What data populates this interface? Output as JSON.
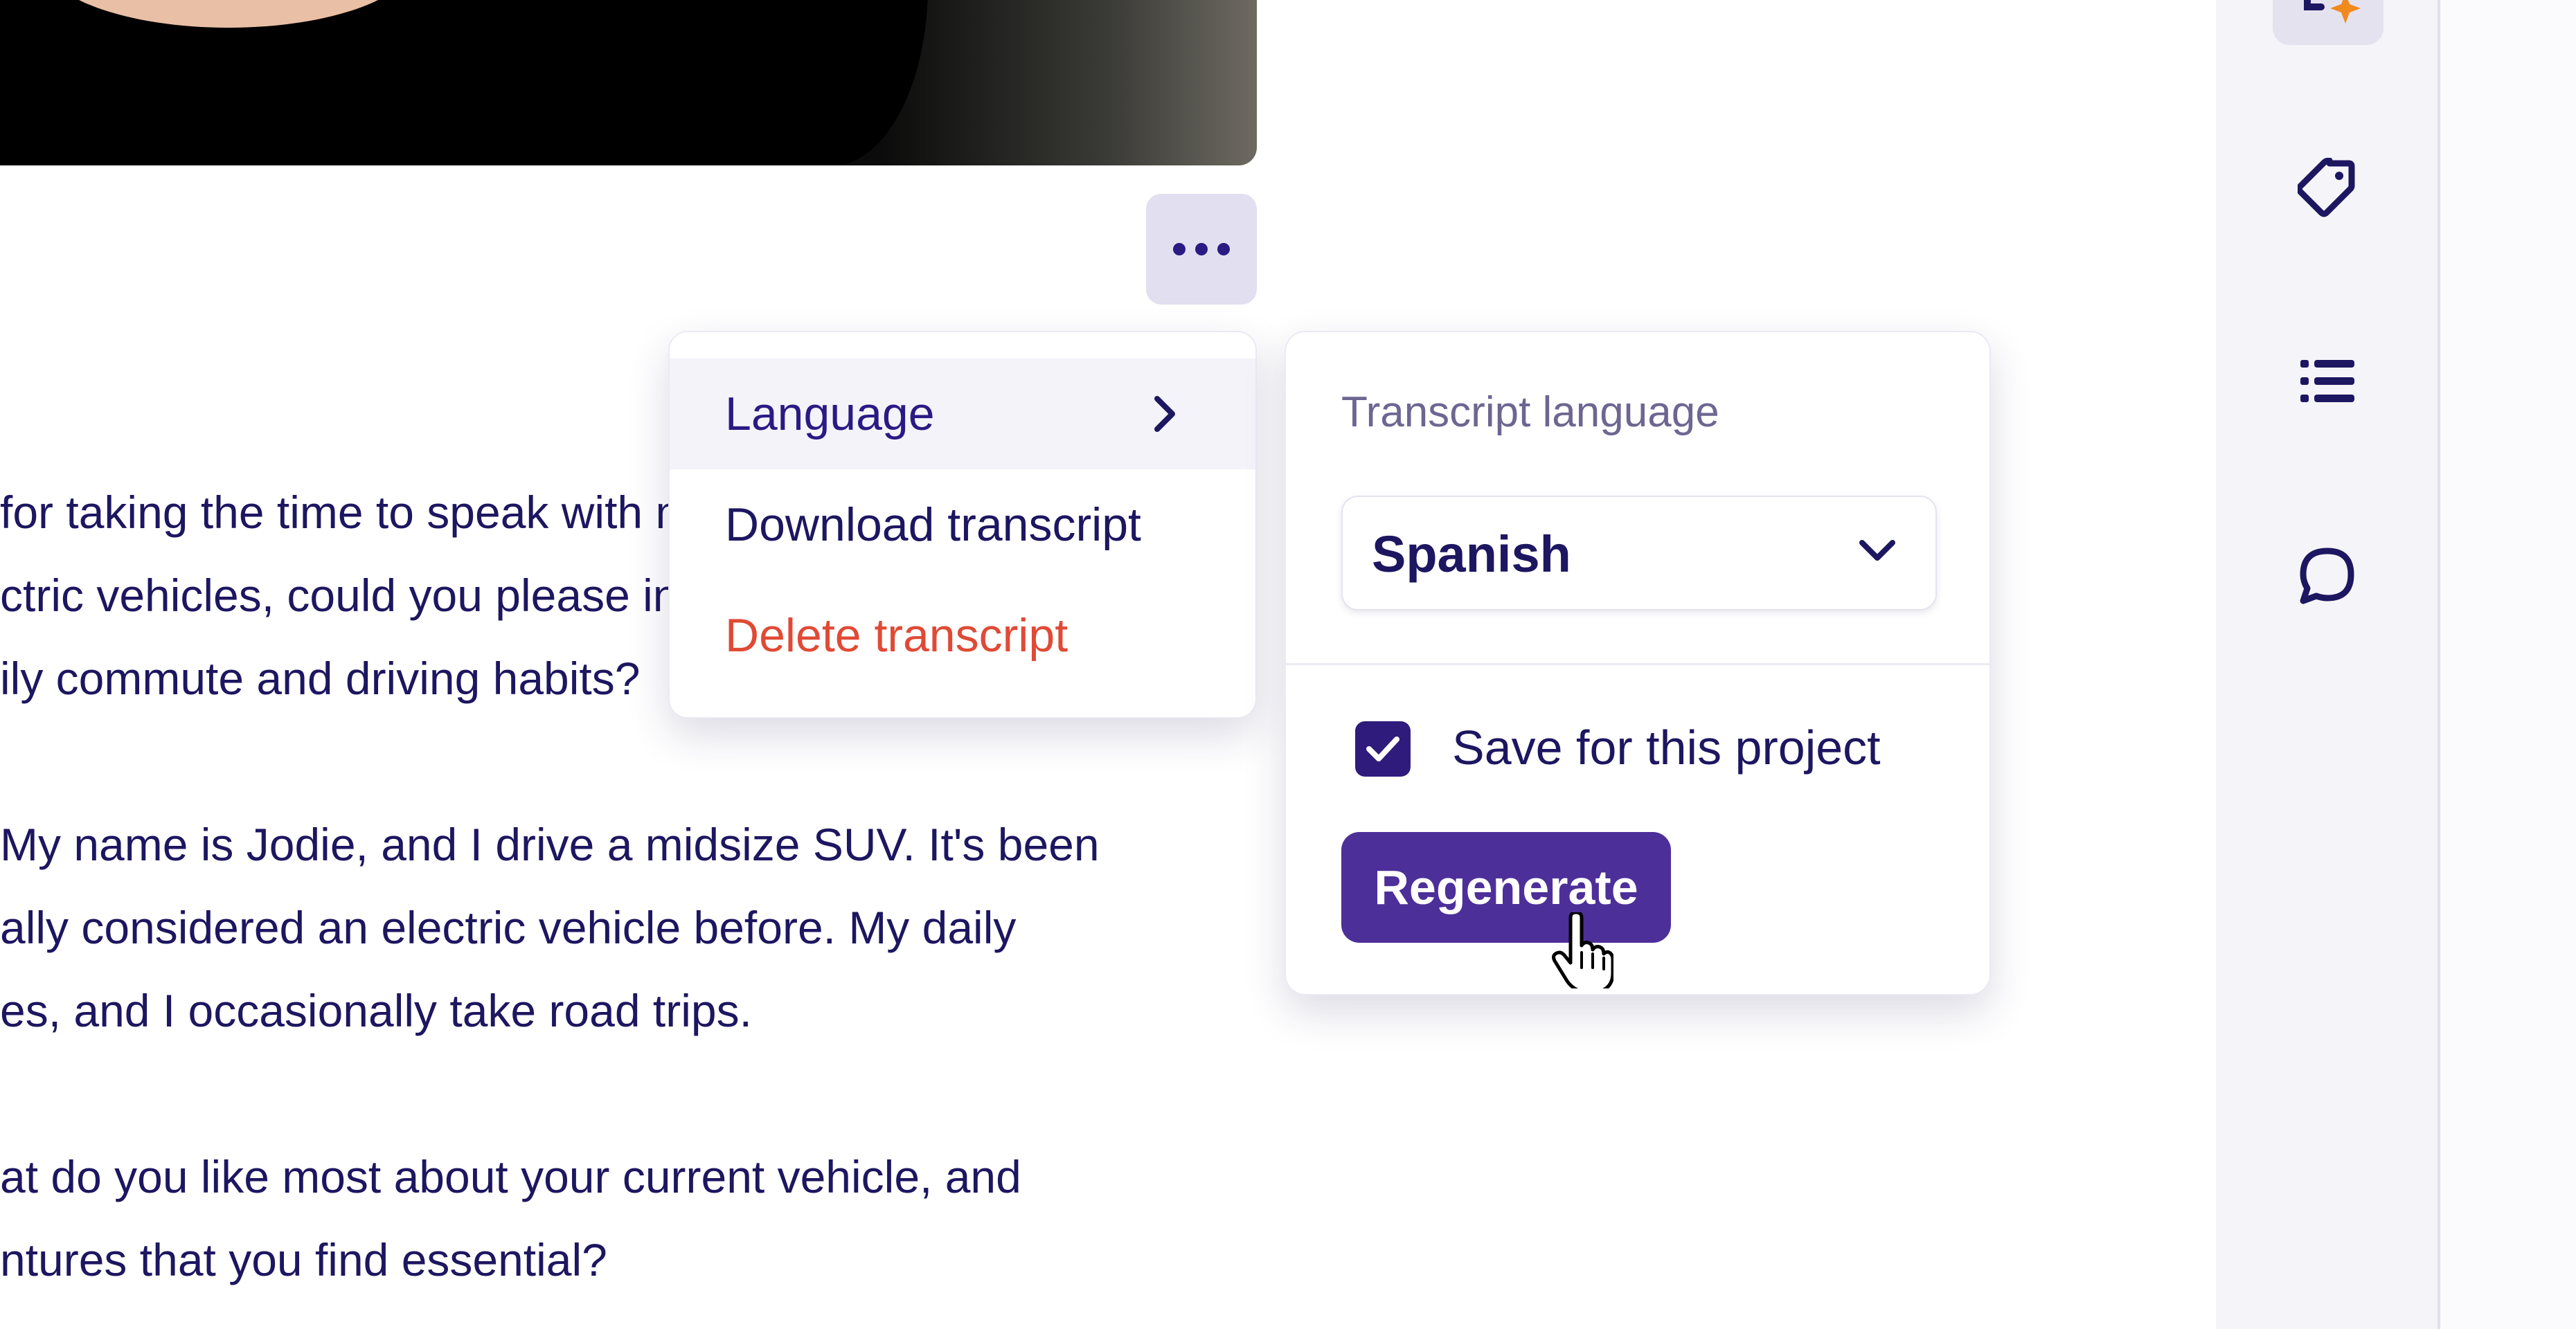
{
  "transcript": {
    "lines": [
      " for taking the time to speak with me about",
      "ctric vehicles, could you please introduce",
      "ily commute and driving habits?",
      "My name is Jodie, and I drive a midsize SUV. It's been",
      "ally considered an electric vehicle before. My daily",
      "es, and I occasionally take road trips.",
      "at do you like most about your current vehicle, and",
      "ntures that you find essential?"
    ]
  },
  "menu": {
    "items": [
      {
        "label": "Language"
      },
      {
        "label": "Download transcript"
      },
      {
        "label": "Delete transcript"
      }
    ]
  },
  "language_panel": {
    "label": "Transcript language",
    "selected": "Spanish",
    "save_label": "Save for this project",
    "save_checked": true,
    "regenerate_label": "Regenerate"
  },
  "colors": {
    "accent": "#4d2f99",
    "text": "#1d1660",
    "danger": "#e04a35",
    "muted": "#6e6691"
  },
  "icons": [
    "more-dots-icon",
    "chevron-right-icon",
    "chevron-down-icon",
    "check-icon",
    "sparkle-icon",
    "tag-icon",
    "list-icon",
    "comment-icon",
    "hand-cursor-icon"
  ]
}
